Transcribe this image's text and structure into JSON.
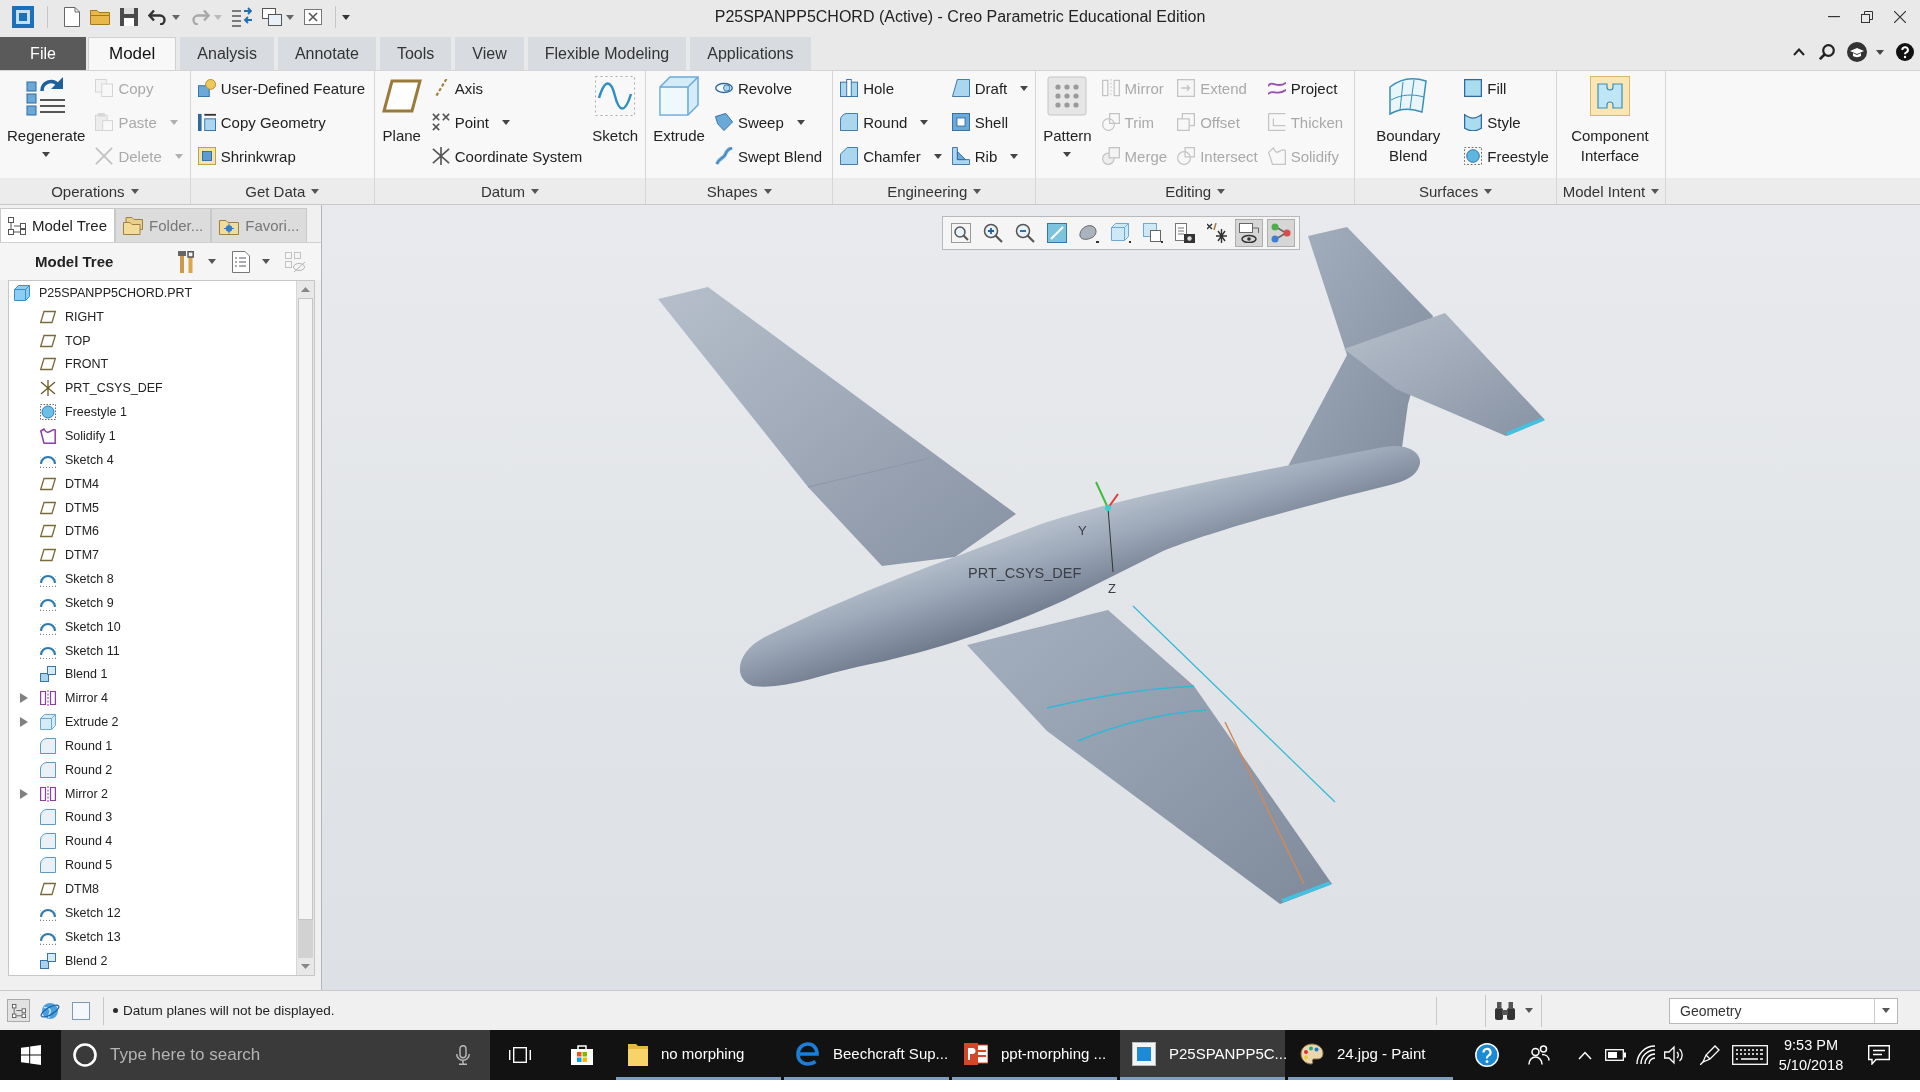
{
  "window": {
    "title": "P25SPANPP5CHORD (Active) - Creo Parametric Educational Edition"
  },
  "quick_access": [
    {
      "disabled": false
    },
    {
      "disabled": false
    },
    {
      "disabled": false
    },
    {
      "disabled": false
    },
    {
      "disabled": true
    },
    {
      "disabled": false
    },
    {
      "disabled": false
    },
    {
      "disabled": false
    }
  ],
  "ribbon_tabs": [
    {
      "label": "File",
      "kind": "menu",
      "selected": false
    },
    {
      "label": "Model",
      "kind": "tab",
      "selected": true
    },
    {
      "label": "Analysis",
      "kind": "tab",
      "selected": false
    },
    {
      "label": "Annotate",
      "kind": "tab",
      "selected": false
    },
    {
      "label": "Tools",
      "kind": "tab",
      "selected": false
    },
    {
      "label": "View",
      "kind": "tab",
      "selected": false
    },
    {
      "label": "Flexible Modeling",
      "kind": "tab",
      "selected": false
    },
    {
      "label": "Applications",
      "kind": "tab",
      "selected": false
    }
  ],
  "ribbon_groups": [
    {
      "label": "Operations",
      "items": [
        {
          "label": "Regenerate",
          "kind": "large",
          "dropdown": true,
          "disabled": false
        },
        {
          "label": "Copy",
          "kind": "small",
          "dropdown": false,
          "disabled": true
        },
        {
          "label": "Paste",
          "kind": "small",
          "dropdown": true,
          "disabled": true
        },
        {
          "label": "Delete",
          "kind": "small",
          "dropdown": true,
          "disabled": true
        }
      ]
    },
    {
      "label": "Get Data",
      "items": [
        {
          "label": "User-Defined Feature",
          "kind": "small",
          "dropdown": false,
          "disabled": false
        },
        {
          "label": "Copy Geometry",
          "kind": "small",
          "dropdown": false,
          "disabled": false
        },
        {
          "label": "Shrinkwrap",
          "kind": "small",
          "dropdown": false,
          "disabled": false
        }
      ]
    },
    {
      "label": "Datum",
      "items": [
        {
          "label": "Plane",
          "kind": "large",
          "dropdown": false,
          "disabled": false
        },
        {
          "label": "Axis",
          "kind": "small",
          "dropdown": false,
          "disabled": false
        },
        {
          "label": "Point",
          "kind": "small",
          "dropdown": true,
          "disabled": false
        },
        {
          "label": "Coordinate System",
          "kind": "small",
          "dropdown": false,
          "disabled": false
        },
        {
          "label": "Sketch",
          "kind": "large",
          "dropdown": false,
          "disabled": false
        }
      ]
    },
    {
      "label": "Shapes",
      "items": [
        {
          "label": "Extrude",
          "kind": "large",
          "dropdown": false,
          "disabled": false
        },
        {
          "label": "Revolve",
          "kind": "small",
          "dropdown": false,
          "disabled": false
        },
        {
          "label": "Sweep",
          "kind": "small",
          "dropdown": true,
          "disabled": false
        },
        {
          "label": "Swept Blend",
          "kind": "small",
          "dropdown": false,
          "disabled": false
        }
      ]
    },
    {
      "label": "Engineering",
      "items": [
        {
          "label": "Hole",
          "kind": "small",
          "dropdown": false,
          "disabled": false
        },
        {
          "label": "Round",
          "kind": "small",
          "dropdown": true,
          "disabled": false
        },
        {
          "label": "Chamfer",
          "kind": "small",
          "dropdown": true,
          "disabled": false
        },
        {
          "label": "Draft",
          "kind": "small",
          "dropdown": true,
          "disabled": false
        },
        {
          "label": "Shell",
          "kind": "small",
          "dropdown": false,
          "disabled": false
        },
        {
          "label": "Rib",
          "kind": "small",
          "dropdown": true,
          "disabled": false
        }
      ]
    },
    {
      "label": "Editing",
      "items": [
        {
          "label": "Pattern",
          "kind": "large",
          "dropdown": true,
          "disabled": false
        },
        {
          "label": "Mirror",
          "kind": "small",
          "dropdown": false,
          "disabled": true
        },
        {
          "label": "Trim",
          "kind": "small",
          "dropdown": false,
          "disabled": true
        },
        {
          "label": "Merge",
          "kind": "small",
          "dropdown": false,
          "disabled": true
        },
        {
          "label": "Extend",
          "kind": "small",
          "dropdown": false,
          "disabled": true
        },
        {
          "label": "Offset",
          "kind": "small",
          "dropdown": false,
          "disabled": true
        },
        {
          "label": "Intersect",
          "kind": "small",
          "dropdown": false,
          "disabled": true
        },
        {
          "label": "Project",
          "kind": "small",
          "dropdown": false,
          "disabled": false
        },
        {
          "label": "Thicken",
          "kind": "small",
          "dropdown": false,
          "disabled": true
        },
        {
          "label": "Solidify",
          "kind": "small",
          "dropdown": false,
          "disabled": true
        }
      ]
    },
    {
      "label": "Surfaces",
      "items": [
        {
          "label": "Boundary Blend",
          "kind": "large",
          "dropdown": false,
          "disabled": false
        },
        {
          "label": "Fill",
          "kind": "small",
          "dropdown": false,
          "disabled": false
        },
        {
          "label": "Style",
          "kind": "small",
          "dropdown": false,
          "disabled": false
        },
        {
          "label": "Freestyle",
          "kind": "small",
          "dropdown": false,
          "disabled": false
        }
      ]
    },
    {
      "label": "Model Intent",
      "items": [
        {
          "label": "Component Interface",
          "kind": "large",
          "dropdown": false,
          "disabled": false
        }
      ]
    }
  ],
  "model_tree": {
    "tabs": [
      {
        "label": "Model Tree",
        "selected": true
      },
      {
        "label": "Folder...",
        "selected": false
      },
      {
        "label": "Favori...",
        "selected": false
      }
    ],
    "title": "Model Tree",
    "root": {
      "label": "P25SPANPP5CHORD.PRT",
      "kind": "part",
      "children": [
        {
          "label": "RIGHT",
          "kind": "plane",
          "collapsed": false
        },
        {
          "label": "TOP",
          "kind": "plane",
          "collapsed": false
        },
        {
          "label": "FRONT",
          "kind": "plane",
          "collapsed": false
        },
        {
          "label": "PRT_CSYS_DEF",
          "kind": "csys",
          "collapsed": false
        },
        {
          "label": "Freestyle 1",
          "kind": "freestyle",
          "collapsed": false
        },
        {
          "label": "Solidify 1",
          "kind": "solidify",
          "collapsed": false
        },
        {
          "label": "Sketch 4",
          "kind": "sketch",
          "collapsed": false
        },
        {
          "label": "DTM4",
          "kind": "plane",
          "collapsed": false
        },
        {
          "label": "DTM5",
          "kind": "plane",
          "collapsed": false
        },
        {
          "label": "DTM6",
          "kind": "plane",
          "collapsed": false
        },
        {
          "label": "DTM7",
          "kind": "plane",
          "collapsed": false
        },
        {
          "label": "Sketch 8",
          "kind": "sketch",
          "collapsed": false
        },
        {
          "label": "Sketch 9",
          "kind": "sketch",
          "collapsed": false
        },
        {
          "label": "Sketch 10",
          "kind": "sketch",
          "collapsed": false
        },
        {
          "label": "Sketch 11",
          "kind": "sketch",
          "collapsed": false
        },
        {
          "label": "Blend 1",
          "kind": "blend",
          "collapsed": false
        },
        {
          "label": "Mirror 4",
          "kind": "mirror",
          "collapsed": true
        },
        {
          "label": "Extrude 2",
          "kind": "extrude",
          "collapsed": true
        },
        {
          "label": "Round 1",
          "kind": "round",
          "collapsed": false
        },
        {
          "label": "Round 2",
          "kind": "round",
          "collapsed": false
        },
        {
          "label": "Mirror 2",
          "kind": "mirror",
          "collapsed": true
        },
        {
          "label": "Round 3",
          "kind": "round",
          "collapsed": false
        },
        {
          "label": "Round 4",
          "kind": "round",
          "collapsed": false
        },
        {
          "label": "Round 5",
          "kind": "round",
          "collapsed": false
        },
        {
          "label": "DTM8",
          "kind": "plane",
          "collapsed": false
        },
        {
          "label": "Sketch 12",
          "kind": "sketch",
          "collapsed": false
        },
        {
          "label": "Sketch 13",
          "kind": "sketch",
          "collapsed": false
        },
        {
          "label": "Blend 2",
          "kind": "blend",
          "collapsed": false
        }
      ]
    }
  },
  "graphics_area": {
    "view_toolbar": [
      {
        "pressed": false
      },
      {
        "pressed": false
      },
      {
        "pressed": false
      },
      {
        "pressed": false
      },
      {
        "pressed": false
      },
      {
        "pressed": false
      },
      {
        "pressed": false
      },
      {
        "pressed": false
      },
      {
        "pressed": false
      },
      {
        "pressed": true
      },
      {
        "pressed": true
      }
    ],
    "csys_label": "PRT_CSYS_DEF",
    "axis_labels": [
      "Y",
      "Z"
    ]
  },
  "status_bar": {
    "message": "Datum planes will not be displayed.",
    "selection_filter": "Geometry"
  },
  "taskbar": {
    "search": {
      "placeholder": "Type here to search"
    },
    "apps": [
      {
        "label": "no morphing",
        "kind": "folder",
        "selected": false
      },
      {
        "label": "Beechcraft Sup...",
        "kind": "browser",
        "selected": false
      },
      {
        "label": "ppt-morphing ...",
        "kind": "slides",
        "selected": false
      },
      {
        "label": "P25SPANPP5C...",
        "kind": "cad",
        "selected": true
      },
      {
        "label": "24.jpg - Paint",
        "kind": "paint",
        "selected": false
      }
    ],
    "time": "9:53 PM",
    "date": "5/10/2018"
  }
}
